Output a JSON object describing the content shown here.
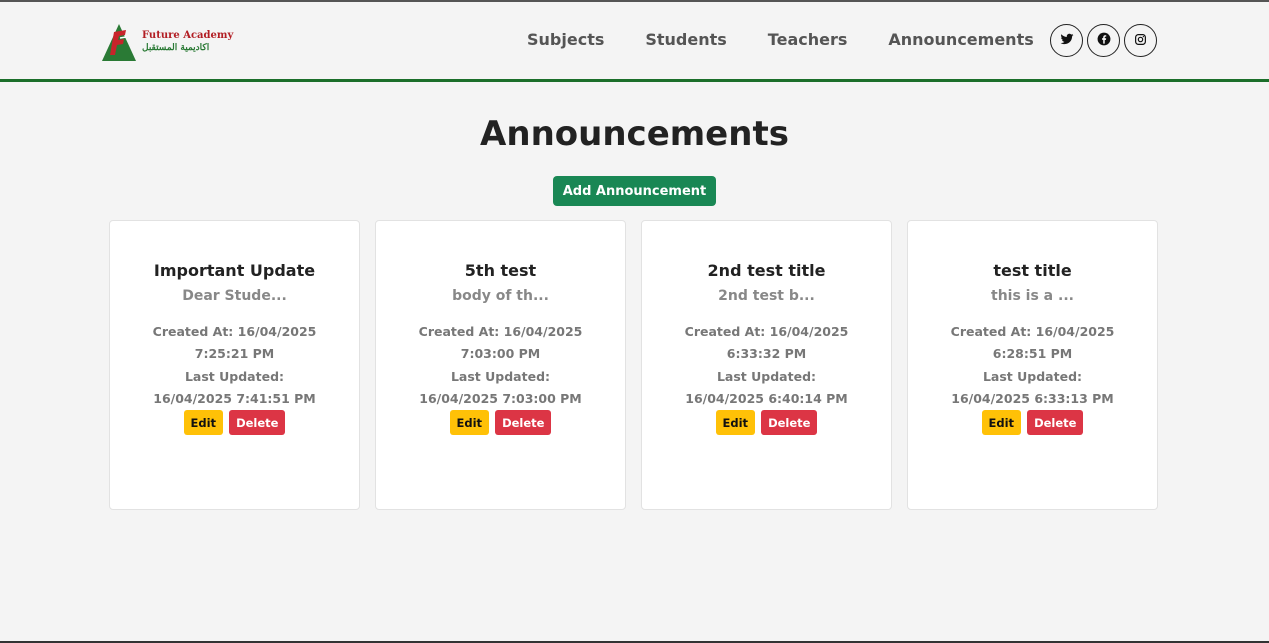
{
  "brand": {
    "name_en": "Future Academy",
    "name_ar": "اكاديمية المستقبل",
    "logo_icon": "future-academy-logo",
    "colors": {
      "red": "#b21e24",
      "green": "#2a7a35"
    }
  },
  "nav": {
    "links": [
      "Subjects",
      "Students",
      "Teachers",
      "Announcements"
    ],
    "socials": [
      {
        "icon": "twitter-icon"
      },
      {
        "icon": "facebook-icon"
      },
      {
        "icon": "instagram-icon"
      }
    ]
  },
  "page": {
    "title": "Announcements",
    "add_label": "Add Announcement"
  },
  "colors": {
    "primary": "#198754",
    "edit": "#ffc107",
    "delete": "#dc3545",
    "nav_border": "#1b6e2a"
  },
  "announcements": [
    {
      "title": "Important Update",
      "body": "Dear Stude...",
      "created": "Created At: 16/04/2025",
      "created_time": "7:25:21 PM",
      "updated_label": "Last Updated:",
      "updated": "16/04/2025 7:41:51 PM",
      "edit_label": "Edit",
      "delete_label": "Delete"
    },
    {
      "title": "5th test",
      "body": "body of th...",
      "created": "Created At: 16/04/2025",
      "created_time": "7:03:00 PM",
      "updated_label": "Last Updated:",
      "updated": "16/04/2025 7:03:00 PM",
      "edit_label": "Edit",
      "delete_label": "Delete"
    },
    {
      "title": "2nd test title",
      "body": "2nd test b...",
      "created": "Created At: 16/04/2025",
      "created_time": "6:33:32 PM",
      "updated_label": "Last Updated:",
      "updated": "16/04/2025 6:40:14 PM",
      "edit_label": "Edit",
      "delete_label": "Delete"
    },
    {
      "title": "test title",
      "body": "this is a ...",
      "created": "Created At: 16/04/2025",
      "created_time": "6:28:51 PM",
      "updated_label": "Last Updated:",
      "updated": "16/04/2025 6:33:13 PM",
      "edit_label": "Edit",
      "delete_label": "Delete"
    }
  ]
}
